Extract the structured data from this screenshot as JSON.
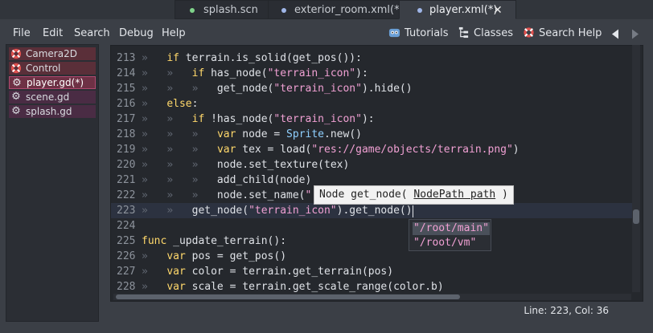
{
  "tabs": [
    {
      "label": "splash.scn",
      "dot_color": "#7fd38a"
    },
    {
      "label": "exterior_room.xml(*)",
      "dot_color": "#9fb6e8"
    },
    {
      "label": "player.xml(*)",
      "dot_color": "#9fb6e8",
      "active": true
    }
  ],
  "menu": [
    "File",
    "Edit",
    "Search",
    "Debug",
    "Help"
  ],
  "toolbar": {
    "tutorials": "Tutorials",
    "classes": "Classes",
    "search_help": "Search Help",
    "back_icon": "triangle-left-icon",
    "forward_icon": "triangle-right-icon"
  },
  "sidebar": {
    "items": [
      {
        "label": "Camera2D",
        "icon": "lifebuoy-icon",
        "color": "#e0524f"
      },
      {
        "label": "Control",
        "icon": "lifebuoy-icon",
        "color": "#e0524f"
      },
      {
        "label": "player.gd(*)",
        "icon": "gear-icon",
        "color": "#d8dbe0",
        "selected": true
      },
      {
        "label": "scene.gd",
        "icon": "gear-icon",
        "color": "#d8dbe0"
      },
      {
        "label": "splash.gd",
        "icon": "gear-icon",
        "color": "#d8dbe0"
      }
    ]
  },
  "editor": {
    "lines": [
      {
        "n": "213",
        "code": "if terrain.is_solid(get_pos()):"
      },
      {
        "n": "214",
        "code": "if has_node(\"terrain_icon\"):"
      },
      {
        "n": "215",
        "code": "get_node(\"terrain_icon\").hide()"
      },
      {
        "n": "216",
        "code": "else:"
      },
      {
        "n": "217",
        "code": "if !has_node(\"terrain_icon\"):"
      },
      {
        "n": "218",
        "code": "var node = Sprite.new()"
      },
      {
        "n": "219",
        "code": "var tex = load(\"res://game/objects/terrain.png\")"
      },
      {
        "n": "220",
        "code": "node.set_texture(tex)"
      },
      {
        "n": "221",
        "code": "add_child(node)"
      },
      {
        "n": "222",
        "code": "node.set_name(\""
      },
      {
        "n": "223",
        "code": "get_node(\"terrain_icon\").get_node()"
      },
      {
        "n": "224",
        "code": ""
      },
      {
        "n": "225",
        "code": "func _update_terrain():"
      },
      {
        "n": "226",
        "code": "var pos = get_pos()"
      },
      {
        "n": "227",
        "code": "var color = terrain.get_terrain(pos)"
      },
      {
        "n": "228",
        "code": "var scale = terrain.get_scale_range(color.b)"
      }
    ],
    "calltip": "Node get_node( NodePath path )",
    "completion": [
      "\"/root/main\"",
      "\"/root/vm\""
    ]
  },
  "status": "Line: 223, Col: 36",
  "colors": {
    "keyword": "#ffd86b",
    "string": "#f0a0d3",
    "type": "#8fd0ff"
  }
}
